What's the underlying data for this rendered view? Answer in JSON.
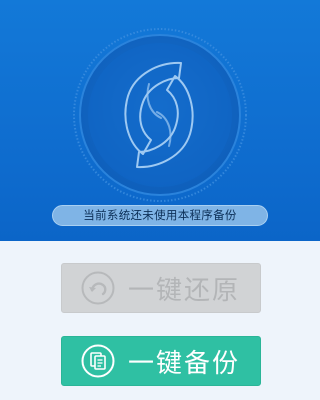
{
  "status": {
    "message": "当前系统还未使用本程序备份"
  },
  "buttons": {
    "restore_label": "一键还原",
    "backup_label": "一键备份"
  },
  "icons": {
    "emblem": "sync-emblem-icon",
    "restore": "undo-arrow-icon",
    "backup": "copy-documents-icon"
  },
  "colors": {
    "header_blue": "#0f6dcf",
    "backup_green": "#2fc0a3",
    "restore_disabled_gray": "#d1d3d5"
  }
}
